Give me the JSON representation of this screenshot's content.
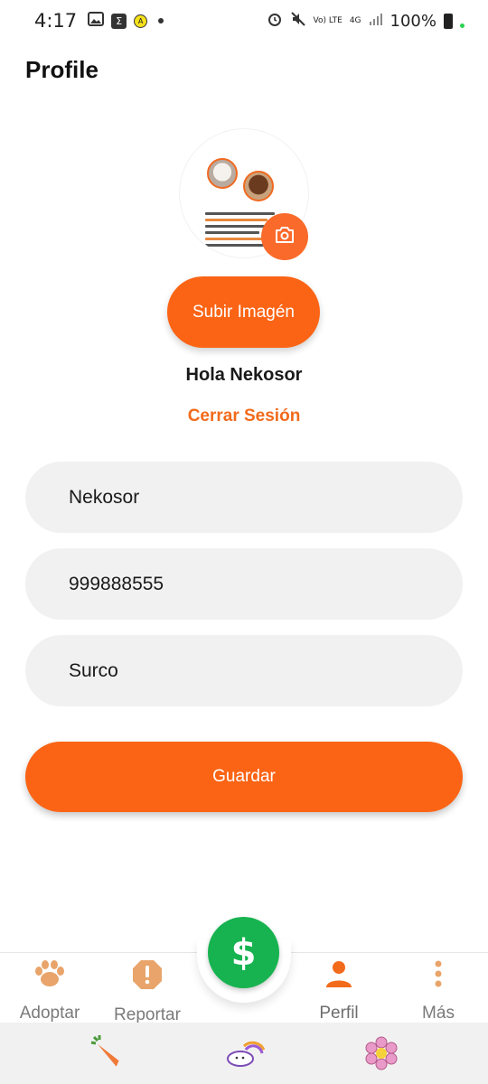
{
  "status_bar": {
    "time": "4:17",
    "sigma": "Σ",
    "alert_letter": "A",
    "volte": "Vo) LTE",
    "network": "4G",
    "battery": "100%"
  },
  "header": {
    "title": "Profile"
  },
  "profile": {
    "upload_label": "Subir Imagén",
    "greeting": "Hola Nekosor",
    "logout_label": "Cerrar Sesión"
  },
  "form": {
    "name_value": "Nekosor",
    "phone_value": "999888555",
    "district_value": "Surco",
    "save_label": "Guardar"
  },
  "bottom_nav": {
    "items": [
      {
        "label": "Adoptar",
        "icon": "paw-icon",
        "color": "#e8a46a"
      },
      {
        "label": "Reportar",
        "icon": "exclamation-icon",
        "color": "#e8a46a"
      },
      {
        "label": "Perfil",
        "icon": "person-icon",
        "color": "#f26a1b",
        "active": true
      },
      {
        "label": "Más",
        "icon": "more-vertical-icon",
        "color": "#e8a46a"
      }
    ],
    "fab_symbol": "$",
    "fab_color": "#17b350"
  },
  "colors": {
    "accent": "#fb6415",
    "field_bg": "#f1f1f1",
    "fab": "#17b350"
  }
}
